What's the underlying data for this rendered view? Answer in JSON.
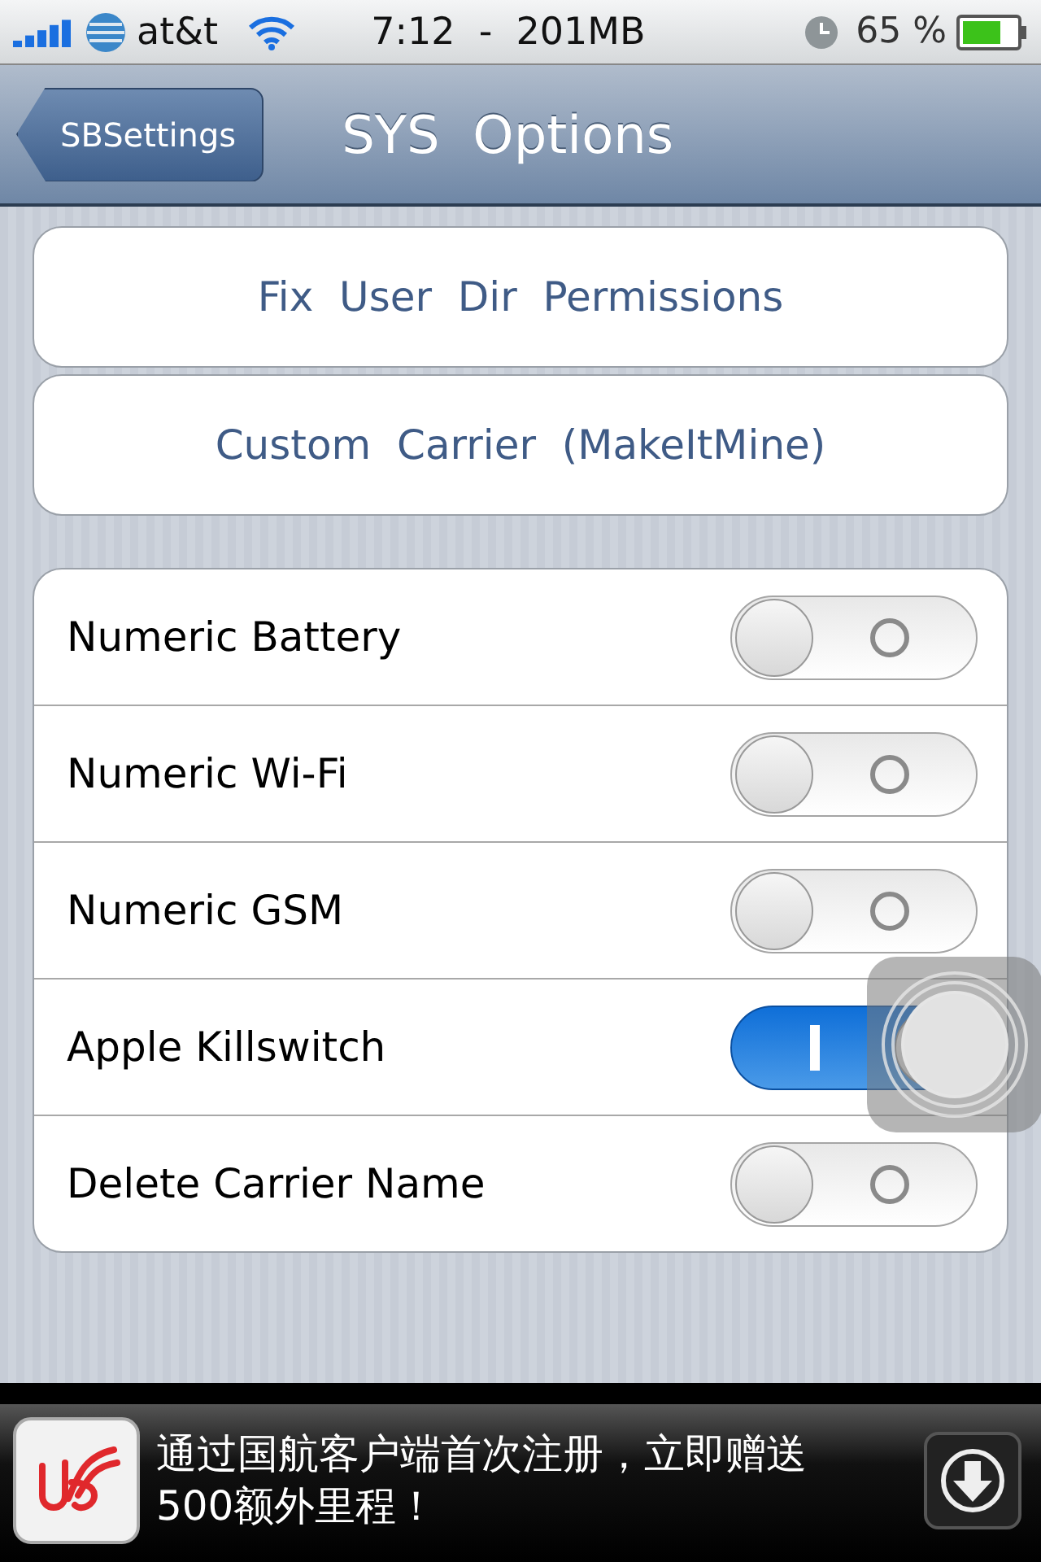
{
  "status_bar": {
    "carrier": "at&t",
    "time": "7:12  -  201MB",
    "battery": "65 %"
  },
  "nav_bar": {
    "back_button": "SBSettings",
    "title": "SYS  Options"
  },
  "action_buttons": [
    "Fix  User  Dir  Permissions",
    "Custom  Carrier  (MakeItMine)"
  ],
  "settings": [
    {
      "label": "Numeric Battery",
      "on": false
    },
    {
      "label": "Numeric Wi-Fi",
      "on": false
    },
    {
      "label": "Numeric GSM",
      "on": false
    },
    {
      "label": "Apple Killswitch",
      "on": true
    },
    {
      "label": "Delete Carrier Name",
      "on": false
    }
  ],
  "ad_banner": {
    "text": "通过国航客户端首次注册，立即赠送500额外里程！"
  }
}
